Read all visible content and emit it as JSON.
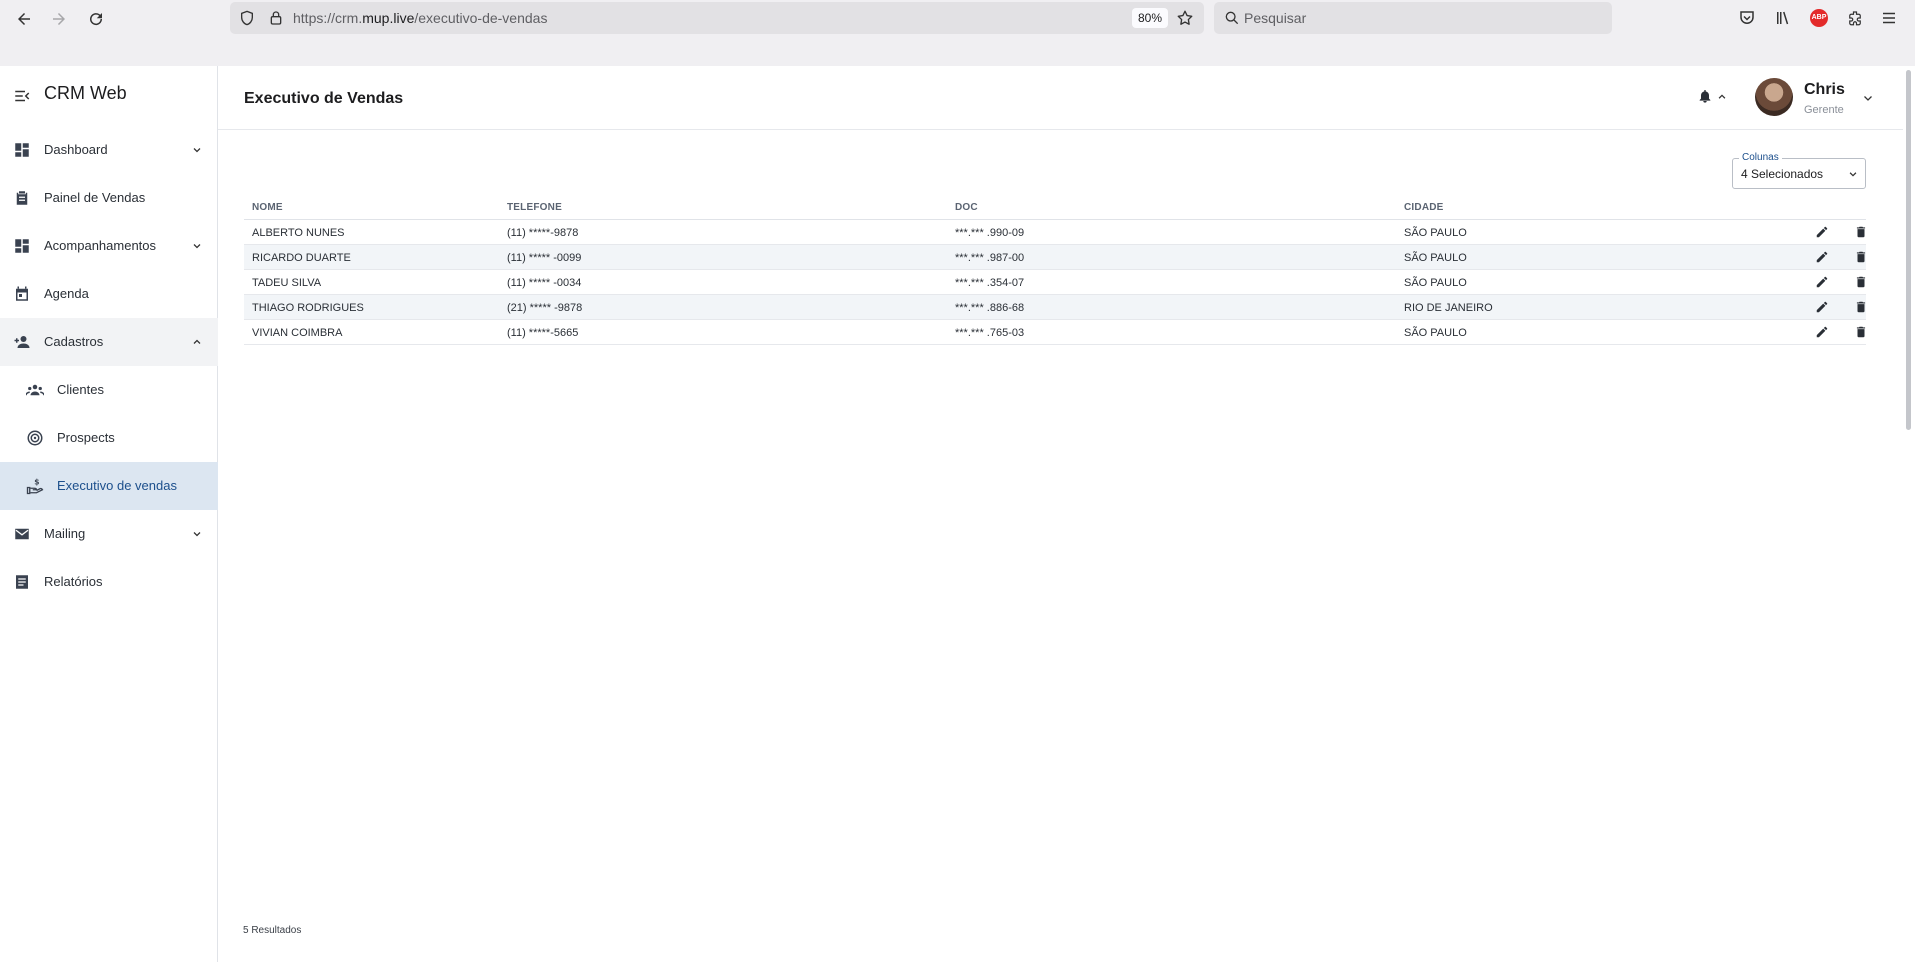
{
  "browser": {
    "url_prefix": "https://crm.",
    "url_host": "mup.live",
    "url_path": "/executivo-de-vendas",
    "zoom": "80%",
    "search_placeholder": "Pesquisar",
    "abp_label": "ABP"
  },
  "sidebar": {
    "brand": "CRM Web",
    "items": {
      "dashboard": "Dashboard",
      "painel": "Painel de Vendas",
      "acompanhamentos": "Acompanhamentos",
      "agenda": "Agenda",
      "cadastros": "Cadastros",
      "clientes": "Clientes",
      "prospects": "Prospects",
      "executivo": "Executivo de vendas",
      "mailing": "Mailing",
      "relatorios": "Relatórios"
    }
  },
  "header": {
    "title": "Executivo de Vendas",
    "user_name": "Chris",
    "user_role": "Gerente"
  },
  "columns_select": {
    "label": "Colunas",
    "value": "4 Selecionados"
  },
  "table": {
    "headers": [
      "NOME",
      "TELEFONE",
      "DOC",
      "CIDADE"
    ],
    "rows": [
      [
        "ALBERTO NUNES",
        "(11)  *****-9878",
        "***.*** .990-09",
        "SÃO PAULO"
      ],
      [
        "RICARDO DUARTE",
        "(11)  ***** -0099",
        "***.*** .987-00",
        "SÃO PAULO"
      ],
      [
        "TADEU SILVA",
        "(11)  ***** -0034",
        "***.*** .354-07",
        "SÃO PAULO"
      ],
      [
        "THIAGO RODRIGUES",
        "(21)  ***** -9878",
        "***.*** .886-68",
        "RIO DE JANEIRO"
      ],
      [
        "VIVIAN COIMBRA",
        "(11)  *****-5665",
        "***.*** .765-03",
        "SÃO PAULO"
      ]
    ]
  },
  "footer": {
    "results": "5 Resultados"
  },
  "colors": {
    "accent": "#1c4f8c",
    "active_bg": "#dce6f1",
    "row_alt": "#f2f5f8"
  }
}
